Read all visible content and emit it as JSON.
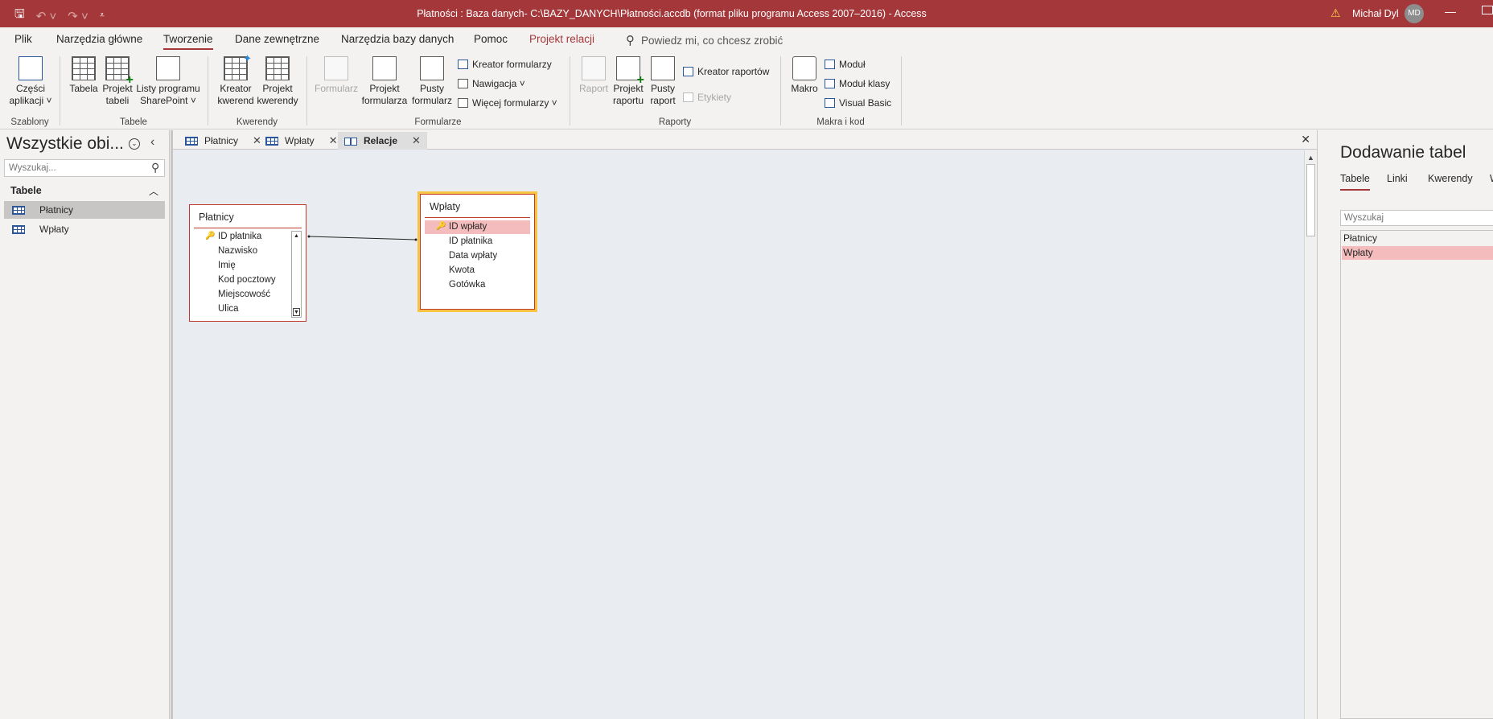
{
  "window": {
    "title": "Płatności : Baza danych- C:\\BAZY_DANYCH\\Płatności.accdb (format pliku programu Access 2007–2016)  -  Access",
    "user": "Michał Dyl",
    "initials": "MD"
  },
  "ribbon_tabs": [
    "Plik",
    "Narzędzia główne",
    "Tworzenie",
    "Dane zewnętrzne",
    "Narzędzia bazy danych",
    "Pomoc",
    "Projekt relacji"
  ],
  "tell_me": "Powiedz mi, co chcesz zrobić",
  "ribbon": {
    "czesci_1": "Części",
    "czesci_2": "aplikacji ˅",
    "tabela": "Tabela",
    "projekt_tabeli_1": "Projekt",
    "projekt_tabeli_2": "tabeli",
    "listy_1": "Listy programu",
    "listy_2": "SharePoint ˅",
    "kreator_kwerend_1": "Kreator",
    "kreator_kwerend_2": "kwerend",
    "projekt_kwerendy_1": "Projekt",
    "projekt_kwerendy_2": "kwerendy",
    "formularz": "Formularz",
    "projekt_formularza_1": "Projekt",
    "projekt_formularza_2": "formularza",
    "pusty_formularz_1": "Pusty",
    "pusty_formularz_2": "formularz",
    "kreator_formularzy": "Kreator formularzy",
    "nawigacja": "Nawigacja ˅",
    "wiecej_formularzy": "Więcej formularzy ˅",
    "raport": "Raport",
    "projekt_raportu_1": "Projekt",
    "projekt_raportu_2": "raportu",
    "pusty_raport_1": "Pusty",
    "pusty_raport_2": "raport",
    "kreator_raportow": "Kreator raportów",
    "etykiety": "Etykiety",
    "makro": "Makro",
    "modul": "Moduł",
    "modul_klasy": "Moduł klasy",
    "visual_basic": "Visual Basic",
    "groups": [
      "Szablony",
      "Tabele",
      "Kwerendy",
      "Formularze",
      "Raporty",
      "Makra i kod"
    ]
  },
  "nav": {
    "title": "Wszystkie obi...",
    "search_placeholder": "Wyszukaj...",
    "group": "Tabele",
    "items": [
      "Płatnicy",
      "Wpłaty"
    ]
  },
  "doc_tabs": [
    "Płatnicy",
    "Wpłaty",
    "Relacje"
  ],
  "tables": {
    "platnicy": {
      "name": "Płatnicy",
      "fields": [
        "ID płatnika",
        "Nazwisko",
        "Imię",
        "Kod pocztowy",
        "Miejscowość",
        "Ulica"
      ]
    },
    "wplaty": {
      "name": "Wpłaty",
      "fields": [
        "ID wpłaty",
        "ID płatnika",
        "Data wpłaty",
        "Kwota",
        "Gotówka"
      ]
    }
  },
  "right_pane": {
    "title": "Dodawanie tabel",
    "tabs": [
      "Tabele",
      "Linki",
      "Kwerendy",
      "W"
    ],
    "search_placeholder": "Wyszukaj",
    "items": [
      "Płatnicy",
      "Wpłaty"
    ]
  },
  "colors": {
    "accent": "#a4373a",
    "selection": "#f4bcbc",
    "highlight_border": "#f7c441"
  }
}
